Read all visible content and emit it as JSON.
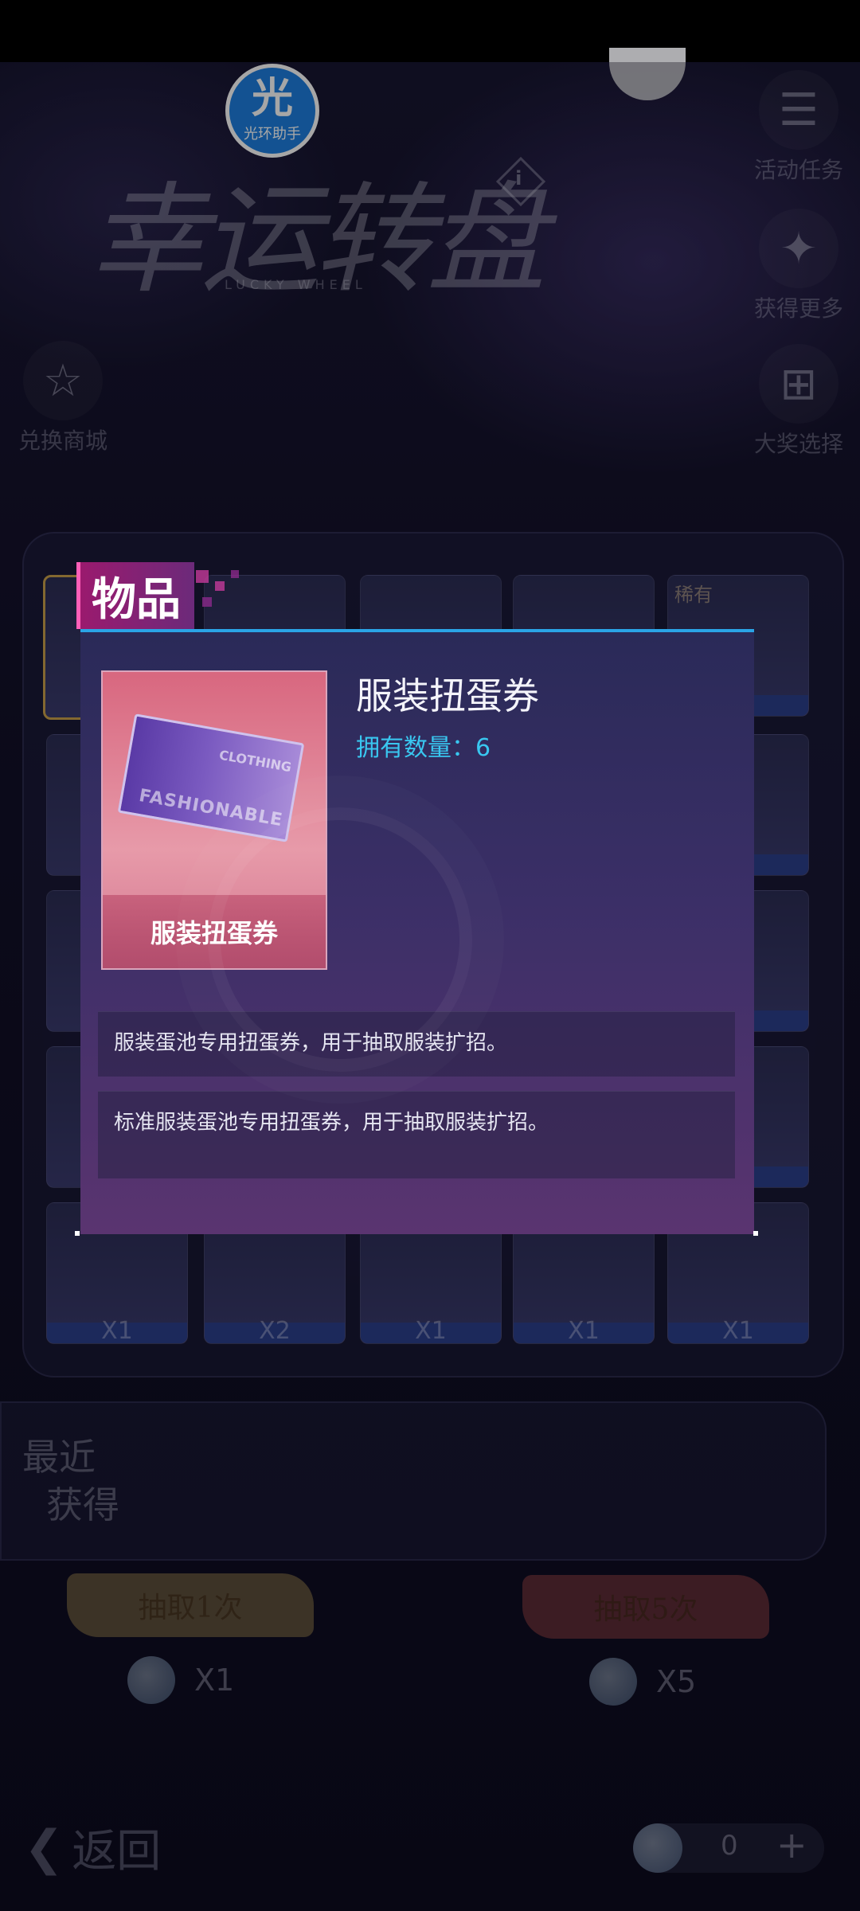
{
  "helper": {
    "glyph": "光",
    "label": "光环助手"
  },
  "title": {
    "main": "幸运转盘",
    "sub": "LUCKY WHEEL"
  },
  "info_icon": "i",
  "side_buttons": {
    "activity_task": "活动任务",
    "get_more": "获得更多",
    "exchange_shop": "兑换商城",
    "grand_prize": "大奖选择"
  },
  "prize_grid": {
    "bottom_row_counts": [
      "X1",
      "X2",
      "X1",
      "X1",
      "X1"
    ],
    "rare_tag": "稀有"
  },
  "recent": {
    "line1": "最近",
    "line2": "获得"
  },
  "draw": {
    "once_label": "抽取1次",
    "once_cost": "X1",
    "five_label": "抽取5次",
    "five_cost": "X5"
  },
  "back_label": "返回",
  "currency": {
    "value": "0",
    "plus": "+"
  },
  "modal": {
    "tab": "物品",
    "item_name": "服装扭蛋券",
    "owned": "拥有数量：6",
    "card_label": "服装扭蛋券",
    "ticket_text_1": "CLOTHING",
    "ticket_text_2": "FASHIONABLE",
    "desc1": "服装蛋池专用扭蛋券，用于抽取服装扩招。",
    "desc2": "标准服装蛋池专用扭蛋券，用于抽取服装扩招。"
  },
  "colors": {
    "accent_blue": "#2aa4e6",
    "owned_text": "#39c7f0",
    "tab_magenta": "#9a1a6e"
  }
}
